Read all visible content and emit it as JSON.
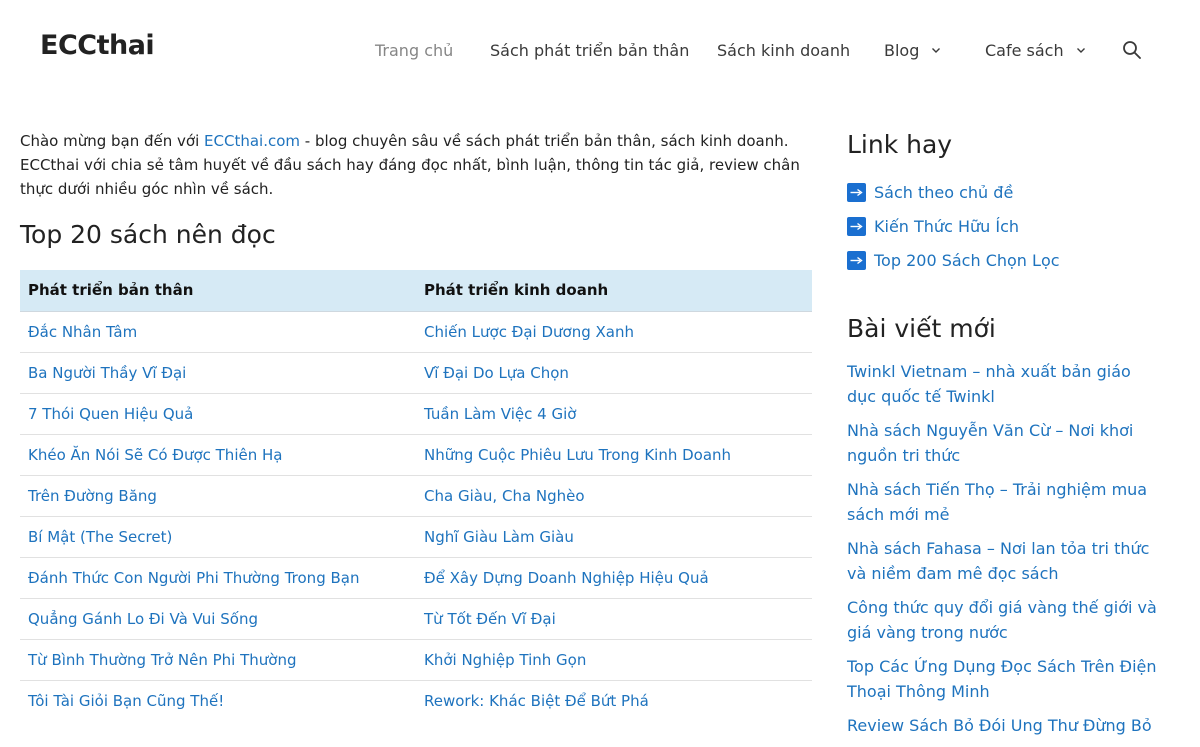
{
  "header": {
    "logo": "ECCthai",
    "nav": [
      {
        "label": "Trang chủ"
      },
      {
        "label": "Sách phát triển bản thân"
      },
      {
        "label": "Sách kinh doanh"
      },
      {
        "label": "Blog"
      },
      {
        "label": "Cafe sách"
      }
    ],
    "search_icon": "search-icon",
    "caret_icon": "chevron-down-icon"
  },
  "main": {
    "intro_before": "Chào mừng bạn đến với ",
    "intro_link": "ECCthai.com",
    "intro_after": " - blog chuyên sâu về sách phát triển bản thân, sách kinh doanh. ECCthai với chia sẻ tâm huyết về đầu sách hay đáng đọc nhất, bình luận, thông tin tác giả, review chân thực dưới nhiều góc nhìn về sách.",
    "heading": "Top 20 sách nên đọc",
    "table": {
      "headers": [
        "Phát triển bản thân",
        "Phát triển kinh doanh"
      ],
      "rows": [
        [
          "Đắc Nhân Tâm",
          "Chiến Lược Đại Dương Xanh"
        ],
        [
          "Ba Người Thầy Vĩ Đại",
          "Vĩ Đại Do Lựa Chọn"
        ],
        [
          "7 Thói Quen Hiệu Quả",
          "Tuần Làm Việc 4 Giờ"
        ],
        [
          "Khéo Ăn Nói Sẽ Có Được Thiên Hạ",
          "Những Cuộc Phiêu Lưu Trong Kinh Doanh"
        ],
        [
          "Trên Đường Băng",
          "Cha Giàu, Cha Nghèo"
        ],
        [
          "Bí Mật (The Secret)",
          "Nghĩ Giàu Làm Giàu"
        ],
        [
          "Đánh Thức Con Người Phi Thường Trong Bạn",
          "Để Xây Dựng Doanh Nghiệp Hiệu Quả"
        ],
        [
          "Quẳng Gánh Lo Đi Và Vui Sống",
          "Từ Tốt Đến Vĩ Đại"
        ],
        [
          "Từ Bình Thường Trở Nên Phi Thường",
          "Khởi Nghiệp Tinh Gọn"
        ],
        [
          "Tôi Tài Giỏi Bạn Cũng Thế!",
          "Rework: Khác Biệt Để Bứt Phá"
        ]
      ]
    }
  },
  "sidebar": {
    "links_title": "Link hay",
    "links": [
      {
        "label": "Sách theo chủ đề"
      },
      {
        "label": "Kiến Thức Hữu Ích"
      },
      {
        "label": "Top 200 Sách Chọn Lọc"
      }
    ],
    "link_icon": "arrow-right-icon",
    "arrow_color": "#1a6fd0",
    "recent_title": "Bài viết mới",
    "recent": [
      {
        "label": "Twinkl Vietnam – nhà xuất bản giáo dục quốc tế Twinkl"
      },
      {
        "label": "Nhà sách Nguyễn Văn Cừ – Nơi khơi nguồn tri thức"
      },
      {
        "label": "Nhà sách Tiến Thọ – Trải nghiệm mua sách mới mẻ"
      },
      {
        "label": "Nhà sách Fahasa – Nơi lan tỏa tri thức và niềm đam mê đọc sách"
      },
      {
        "label": "Công thức quy đổi giá vàng thế giới và giá vàng trong nước"
      },
      {
        "label": "Top Các Ứng Dụng Đọc Sách Trên Điện Thoại Thông Minh"
      },
      {
        "label": "Review Sách Bỏ Đói Ung Thư Đừng Bỏ"
      }
    ]
  },
  "colors": {
    "link": "#1e73be",
    "table_header_bg": "#d6eaf5",
    "nav_active": "#868686"
  }
}
